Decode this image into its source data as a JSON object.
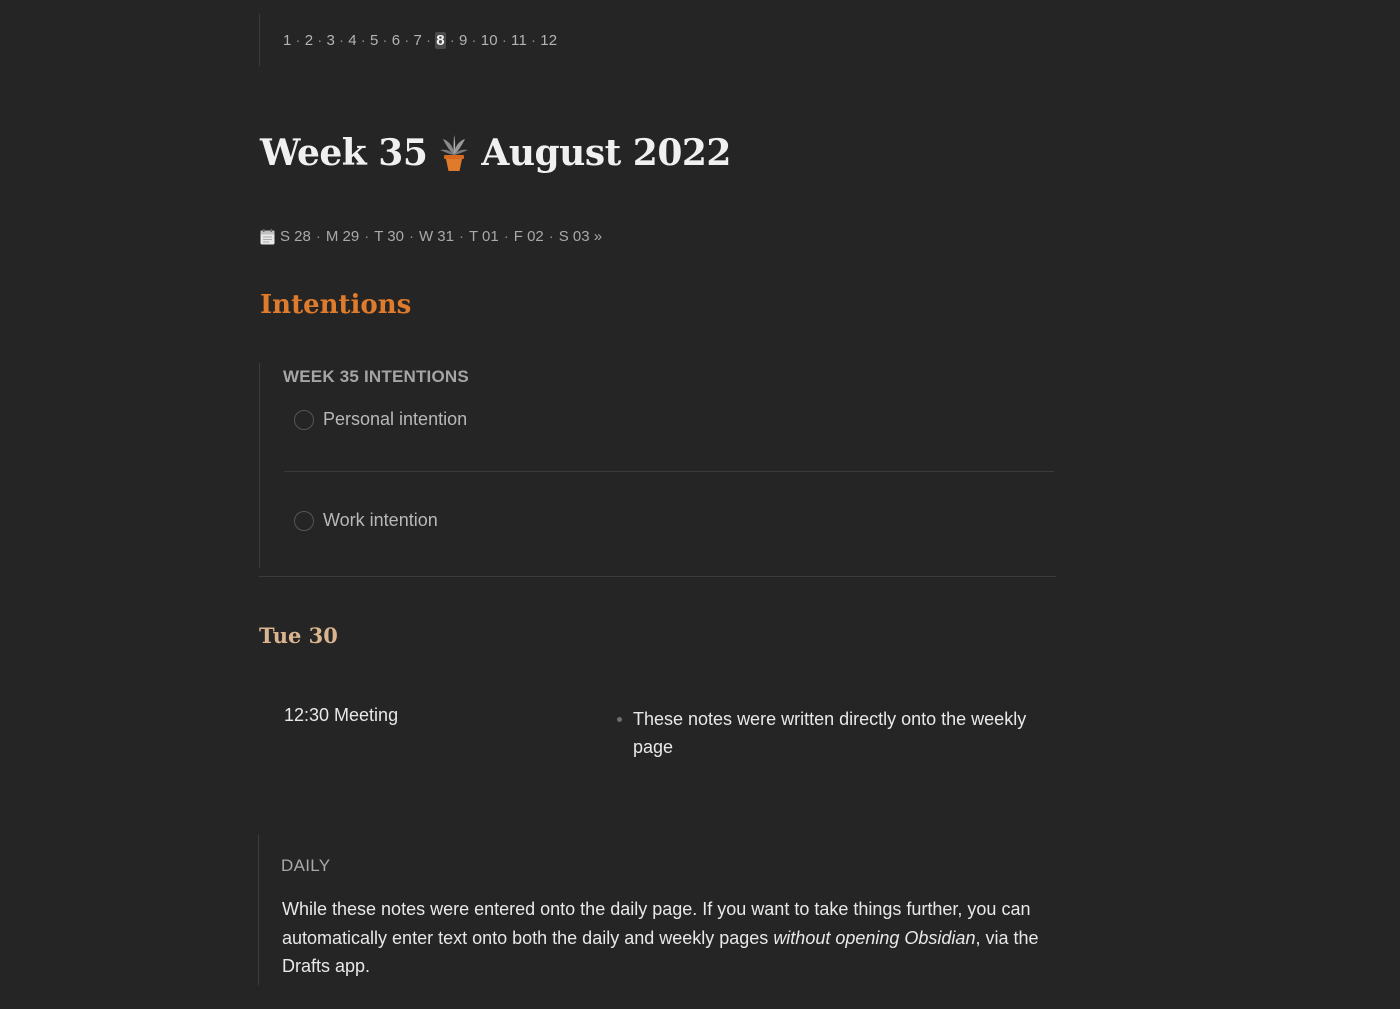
{
  "month_nav": {
    "months": [
      "1",
      "2",
      "3",
      "4",
      "5",
      "6",
      "7",
      "8",
      "9",
      "10",
      "11",
      "12"
    ],
    "current": "8",
    "separator": "·"
  },
  "title": {
    "before": "Week 35",
    "after": "August 2022",
    "icon": "potted-plant-icon"
  },
  "day_nav": {
    "icon": "calendar-icon",
    "days": [
      "S 28",
      "M 29",
      "T 30",
      "W 31",
      "T 01",
      "F 02",
      "S 03 »"
    ],
    "separator": "·"
  },
  "intentions": {
    "heading": "Intentions",
    "callout_title": "WEEK 35 INTENTIONS",
    "tasks": [
      {
        "label": "Personal intention",
        "checked": false
      },
      {
        "label": "Work intention",
        "checked": false
      }
    ]
  },
  "day_section": {
    "heading": "Tue 30",
    "meeting": "12:30 Meeting",
    "note": "These notes were written directly onto the weekly page"
  },
  "daily": {
    "title": "DAILY",
    "body_part1": "While these notes were entered onto the daily page. If you want to take things further, you can automatically enter text onto both the daily and weekly pages ",
    "body_italic": "without opening Obsidian",
    "body_part2": ", via the Drafts app."
  },
  "colors": {
    "background": "#252525",
    "accent_orange": "#e07b2c",
    "day_heading": "#d9b48f"
  }
}
